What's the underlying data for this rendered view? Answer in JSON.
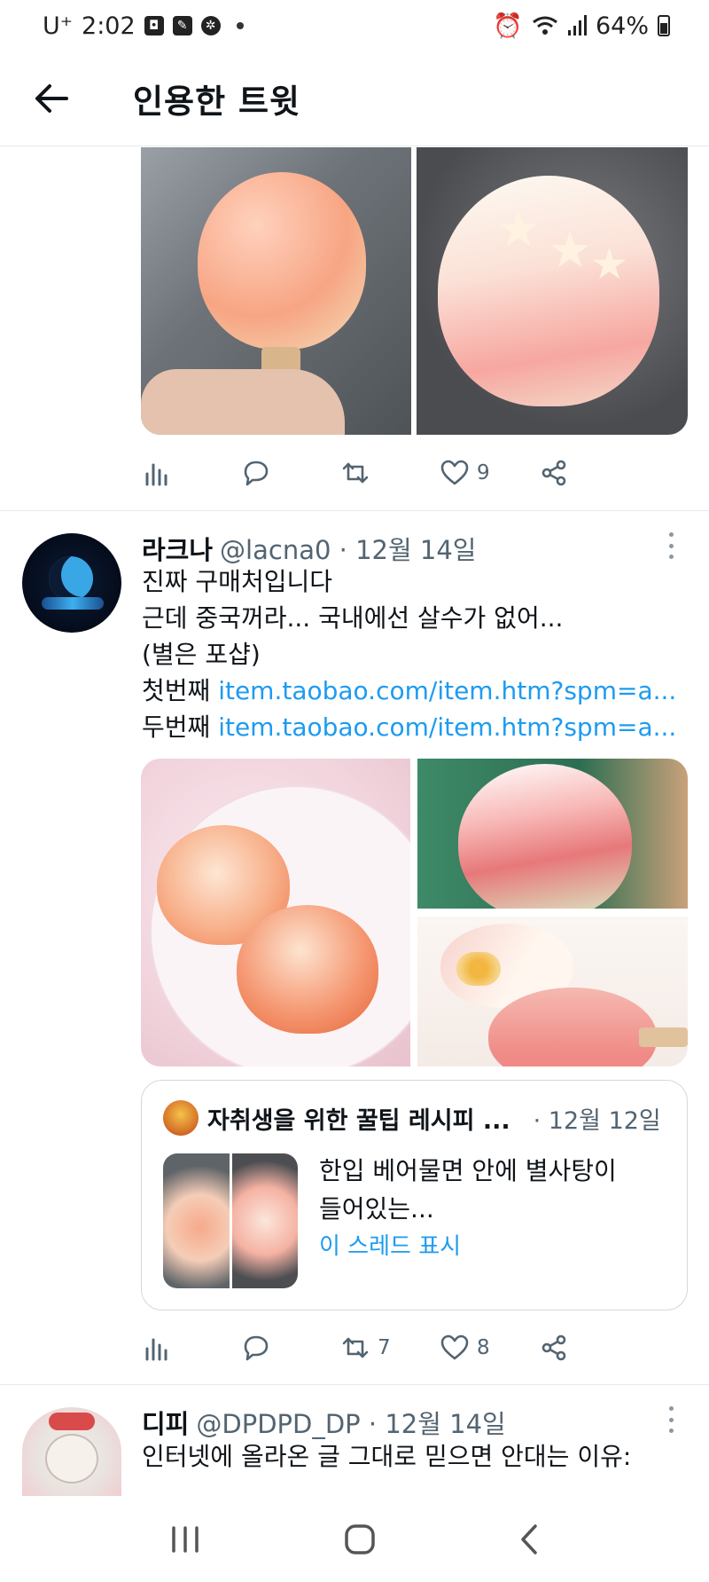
{
  "status_bar": {
    "carrier": "U⁺",
    "time": "2:02",
    "battery": "64%"
  },
  "header": {
    "title": "인용한 트윗"
  },
  "tweet_top": {
    "likes": "9"
  },
  "tweet_main": {
    "name": "라크나",
    "handle": "@lacna0 · 12월 14일",
    "lines": [
      "진짜 구매처입니다",
      "근데 중국꺼라... 국내에선 살수가 없어...",
      "(별은 포샵)"
    ],
    "link_lines": [
      {
        "prefix": "첫번째 ",
        "url": "item.taobao.com/item.htm?spm=a..."
      },
      {
        "prefix": "두번째 ",
        "url": "item.taobao.com/item.htm?spm=a..."
      }
    ],
    "quote": {
      "name": "자취생을 위한 꿀팁 레시피 ...",
      "date": "· 12월 12일",
      "text_line1": "한입 베어물면 안에 별사탕이",
      "text_line2": "들어있는...",
      "show_thread": "이 스레드 표시"
    },
    "retweets": "7",
    "likes": "8"
  },
  "tweet_next": {
    "name": "디피",
    "handle": "@DPDPD_DP · 12월 14일",
    "text": "인터넷에 올라온 글 그대로 믿으면 안대는 이유:"
  },
  "colors": {
    "link": "#1d9bf0",
    "secondary_text": "#536471",
    "border": "#e6e9eb"
  }
}
